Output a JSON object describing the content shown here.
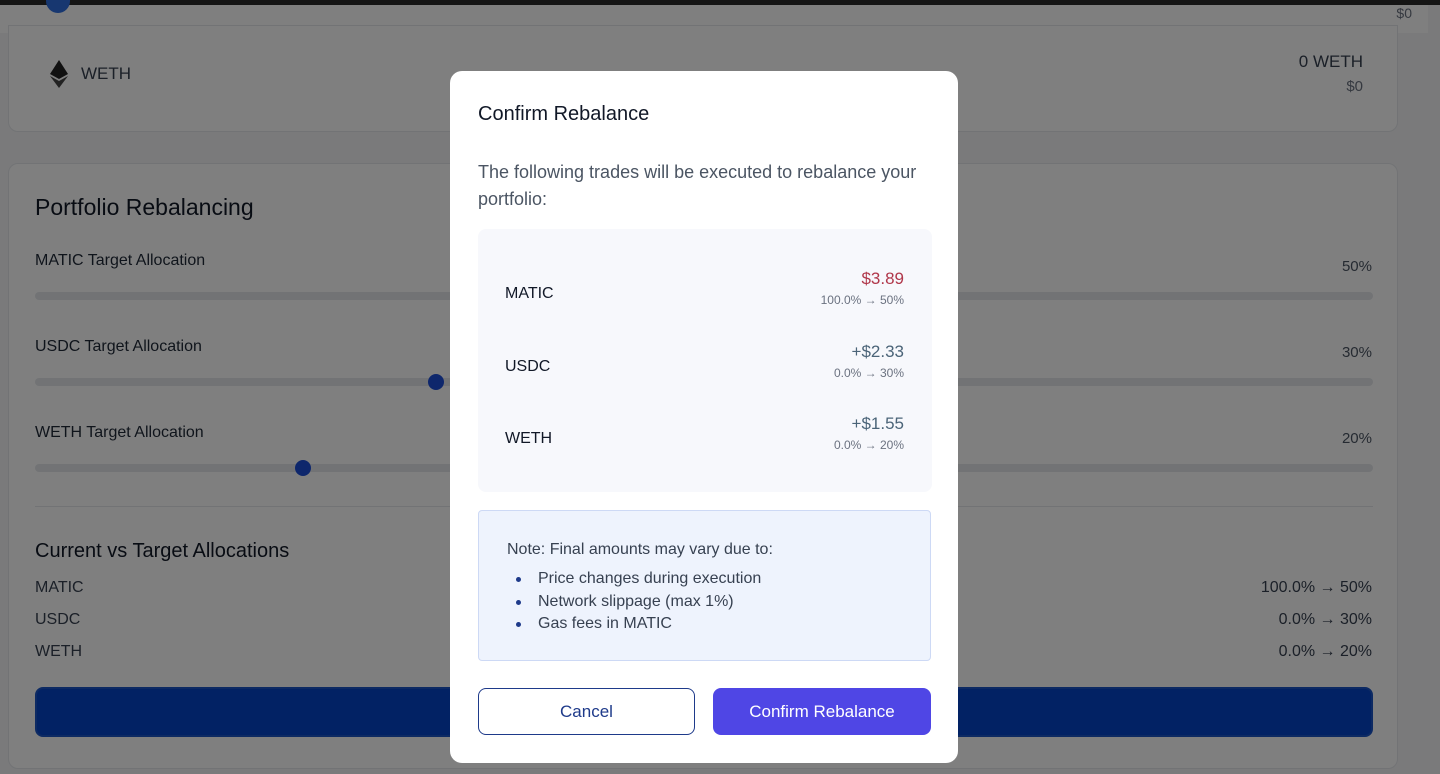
{
  "top": {
    "usd": "$0"
  },
  "assets": {
    "weth": {
      "name": "WETH",
      "amount": "0 WETH",
      "usd": "$0",
      "icon": "ethereum-icon"
    }
  },
  "rebalancing": {
    "title": "Portfolio Rebalancing",
    "allocations": [
      {
        "label": "MATIC Target Allocation",
        "value": "50%",
        "slider_fraction": 0.5
      },
      {
        "label": "USDC Target Allocation",
        "value": "30%",
        "slider_fraction": 0.3
      },
      {
        "label": "WETH Target Allocation",
        "value": "20%",
        "slider_fraction": 0.2
      }
    ],
    "comparison_title": "Current vs Target Allocations",
    "comparison": [
      {
        "asset": "MATIC",
        "change": "100.0% → 50%"
      },
      {
        "asset": "USDC",
        "change": "0.0% → 30%"
      },
      {
        "asset": "WETH",
        "change": "0.0% → 20%"
      }
    ]
  },
  "modal": {
    "title": "Confirm Rebalance",
    "description": "The following trades will be executed to rebalance your portfolio:",
    "trades": [
      {
        "asset": "MATIC",
        "amount": "$3.89",
        "change": "100.0% → 50%",
        "direction": "sell"
      },
      {
        "asset": "USDC",
        "amount": "+$2.33",
        "change": "0.0% → 30%",
        "direction": "buy"
      },
      {
        "asset": "WETH",
        "amount": "+$1.55",
        "change": "0.0% → 20%",
        "direction": "buy"
      }
    ],
    "note": {
      "title": "Note: Final amounts may vary due to:",
      "items": [
        "Price changes during execution",
        "Network slippage (max 1%)",
        "Gas fees in MATIC"
      ]
    },
    "cancel_label": "Cancel",
    "confirm_label": "Confirm Rebalance"
  },
  "colors": {
    "primary": "#4f46e5",
    "slider_thumb": "#1d4ed8",
    "sell_amount": "#b0374a",
    "buy_amount": "#4b6478",
    "overlay": "rgba(0,0,0,0.5)"
  }
}
